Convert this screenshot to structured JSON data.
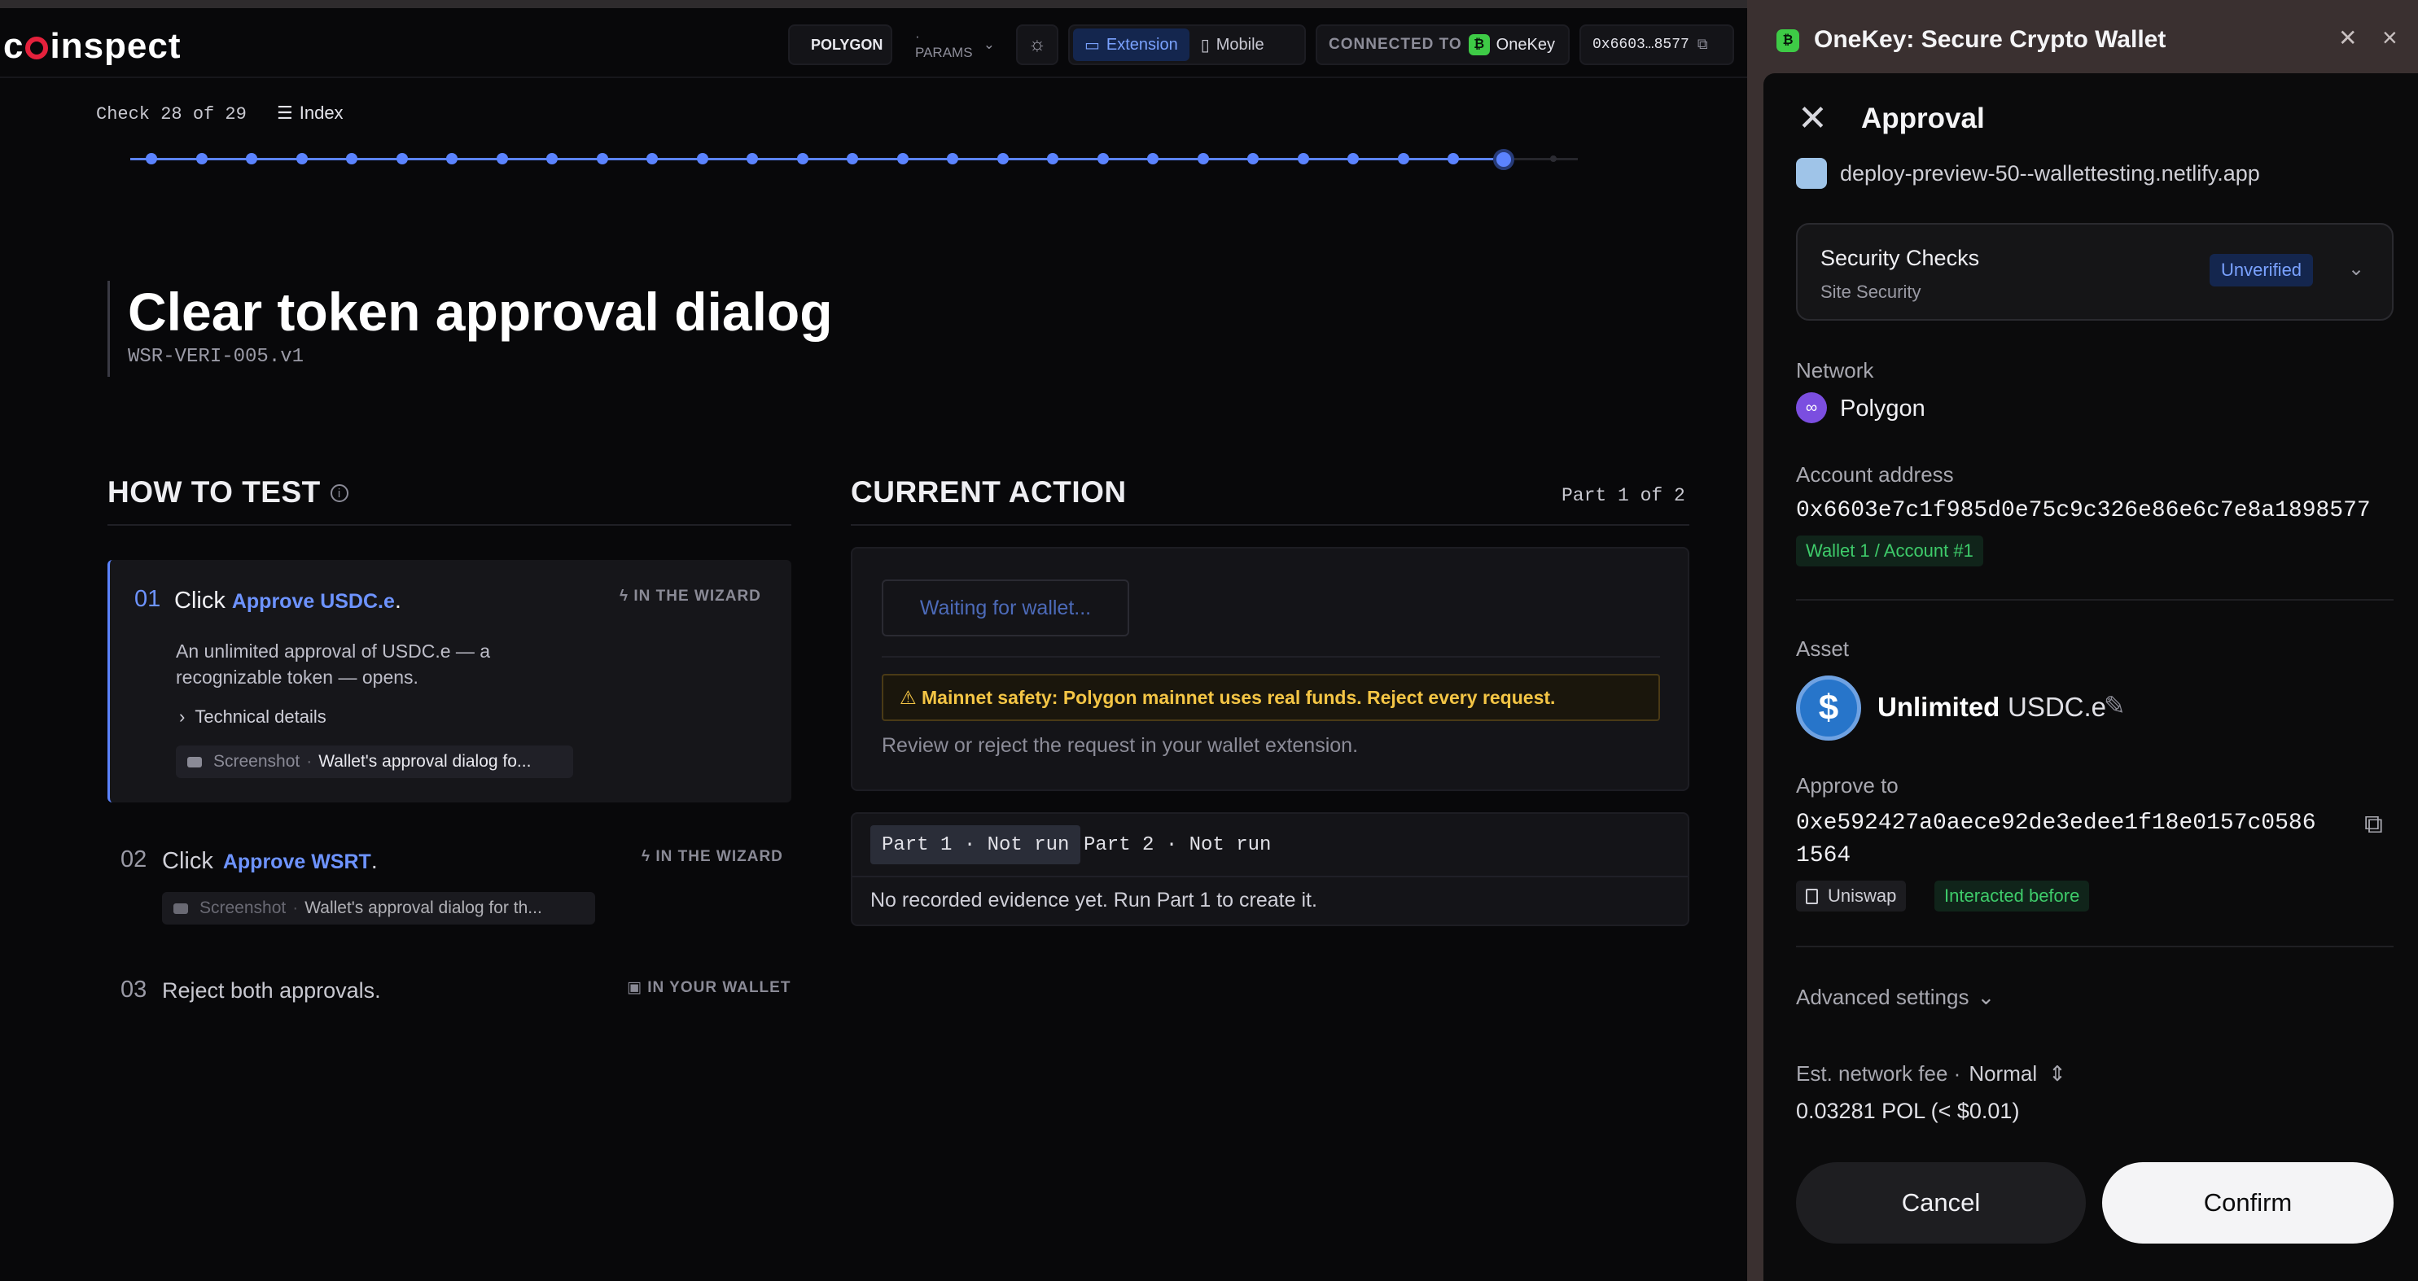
{
  "header": {
    "logo": "coinspect",
    "network": "POLYGON",
    "params": "· PARAMS",
    "theme_icon": "sun-icon",
    "modes": [
      {
        "label": "Extension",
        "icon": "monitor-icon",
        "active": true
      },
      {
        "label": "Mobile",
        "icon": "phone-icon",
        "active": false
      }
    ],
    "connected_label": "CONNECTED TO",
    "wallet_name": "OneKey",
    "address": "0x6603…8577"
  },
  "progress": {
    "label": "Check 28 of 29",
    "index_label": "Index",
    "total": 29,
    "current": 28
  },
  "title": {
    "main": "Clear token approval dialog",
    "id": "WSR-VERI-005.v1"
  },
  "how_to_test": {
    "title": "HOW TO TEST",
    "steps": [
      {
        "num": "01",
        "verb": "Click",
        "link": "Approve USDC.e",
        "suffix": ".",
        "tag": "IN THE WIZARD",
        "desc": "An unlimited approval of USDC.e — a recognizable token — opens.",
        "tech": "Technical details",
        "shot_label": "Screenshot",
        "shot_value": "Wallet's approval dialog fo..."
      },
      {
        "num": "02",
        "verb": "Click",
        "link": "Approve WSRT",
        "suffix": ".",
        "tag": "IN THE WIZARD",
        "shot_label": "Screenshot",
        "shot_value": "Wallet's approval dialog for th..."
      },
      {
        "num": "03",
        "text": "Reject both approvals.",
        "tag": "IN YOUR WALLET"
      }
    ]
  },
  "current_action": {
    "title": "CURRENT ACTION",
    "part_of": "Part 1 of 2",
    "waiting": "Waiting for wallet...",
    "safety": "⚠ Mainnet safety: Polygon mainnet uses real funds. Reject every request.",
    "review": "Review or reject the request in your wallet extension.",
    "tabs": [
      "Part 1 · Not run",
      "Part 2 · Not run"
    ],
    "evidence": "No recorded evidence yet. Run Part 1 to create it."
  },
  "wallet": {
    "window_title": "OneKey: Secure Crypto Wallet",
    "heading": "Approval",
    "site": "deploy-preview-50--wallettesting.netlify.app",
    "security_title": "Security Checks",
    "security_sub": "Site Security",
    "security_badge": "Unverified",
    "network_label": "Network",
    "network_name": "Polygon",
    "account_label": "Account address",
    "account_address": "0x6603e7c1f985d0e75c9c326e86e6c7e8a1898577",
    "account_tag": "Wallet 1 / Account #1",
    "asset_label": "Asset",
    "asset_amount": "Unlimited",
    "asset_symbol": "USDC.e",
    "approve_label": "Approve to",
    "approve_address": "0xe592427a0aece92de3edee1f18e0157c05861564",
    "spender_tag": "Uniswap",
    "interacted_tag": "Interacted before",
    "advanced": "Advanced settings",
    "fee_label": "Est. network fee  ·",
    "fee_speed": "Normal",
    "fee_value": "0.03281 POL (< $0.01)",
    "cancel": "Cancel",
    "confirm": "Confirm"
  }
}
